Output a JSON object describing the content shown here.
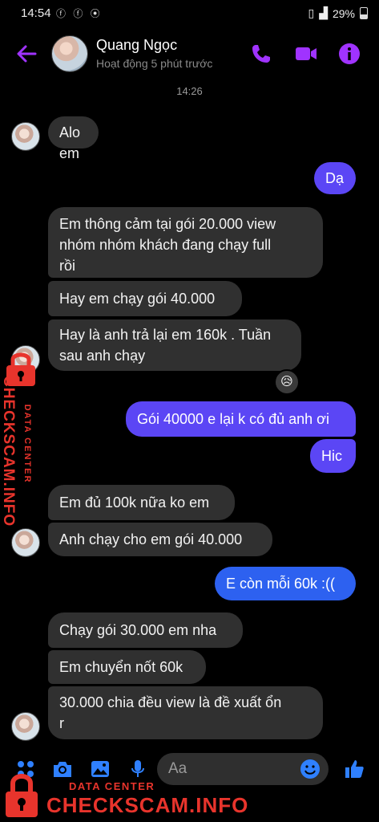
{
  "status_bar": {
    "time": "14:54",
    "battery": "29%"
  },
  "header": {
    "name": "Quang Ngọc",
    "status": "Hoạt động 5 phút trước"
  },
  "timestamp": "14:26",
  "messages": [
    {
      "dir": "in",
      "lines": [
        "Alo em"
      ]
    },
    {
      "dir": "out",
      "lines": [
        "Dạ"
      ]
    },
    {
      "dir": "in",
      "lines": [
        "Em thông cảm tại gói 20.000 view",
        "nhóm nhóm khách đang chạy full",
        "rồi"
      ]
    },
    {
      "dir": "in",
      "lines": [
        "Hay em chạy gói 40.000"
      ]
    },
    {
      "dir": "in",
      "lines": [
        "Hay là anh trả lại em 160k . Tuần",
        "sau anh chạy"
      ]
    },
    {
      "dir": "out",
      "lines": [
        "Gói 40000 e lại k có đủ anh ơi"
      ]
    },
    {
      "dir": "out",
      "lines": [
        "Hic"
      ]
    },
    {
      "dir": "in",
      "lines": [
        "Em đủ 100k nữa ko em"
      ]
    },
    {
      "dir": "in",
      "lines": [
        "Anh chạy cho em gói 40.000"
      ]
    },
    {
      "dir": "out",
      "lines": [
        "E còn mỗi 60k :(("
      ]
    },
    {
      "dir": "in",
      "lines": [
        "Chạy gói 30.000 em nha"
      ]
    },
    {
      "dir": "in",
      "lines": [
        "Em chuyển nốt 60k"
      ]
    },
    {
      "dir": "in",
      "lines": [
        "30.000 chia đều view là đề xuất ổn",
        "r"
      ]
    }
  ],
  "reaction": "😥",
  "composer": {
    "placeholder": "Aa"
  },
  "watermark": {
    "line1": "DATA CENTER",
    "line2": "CHECKSCAM.INFO"
  },
  "colors": {
    "accent": "#a033ff",
    "outgoing": "#5b46f5",
    "outgoing_last": "#2d61f0",
    "incoming": "#303030",
    "blue_icons": "#2f80ff",
    "watermark": "#e8342c"
  }
}
